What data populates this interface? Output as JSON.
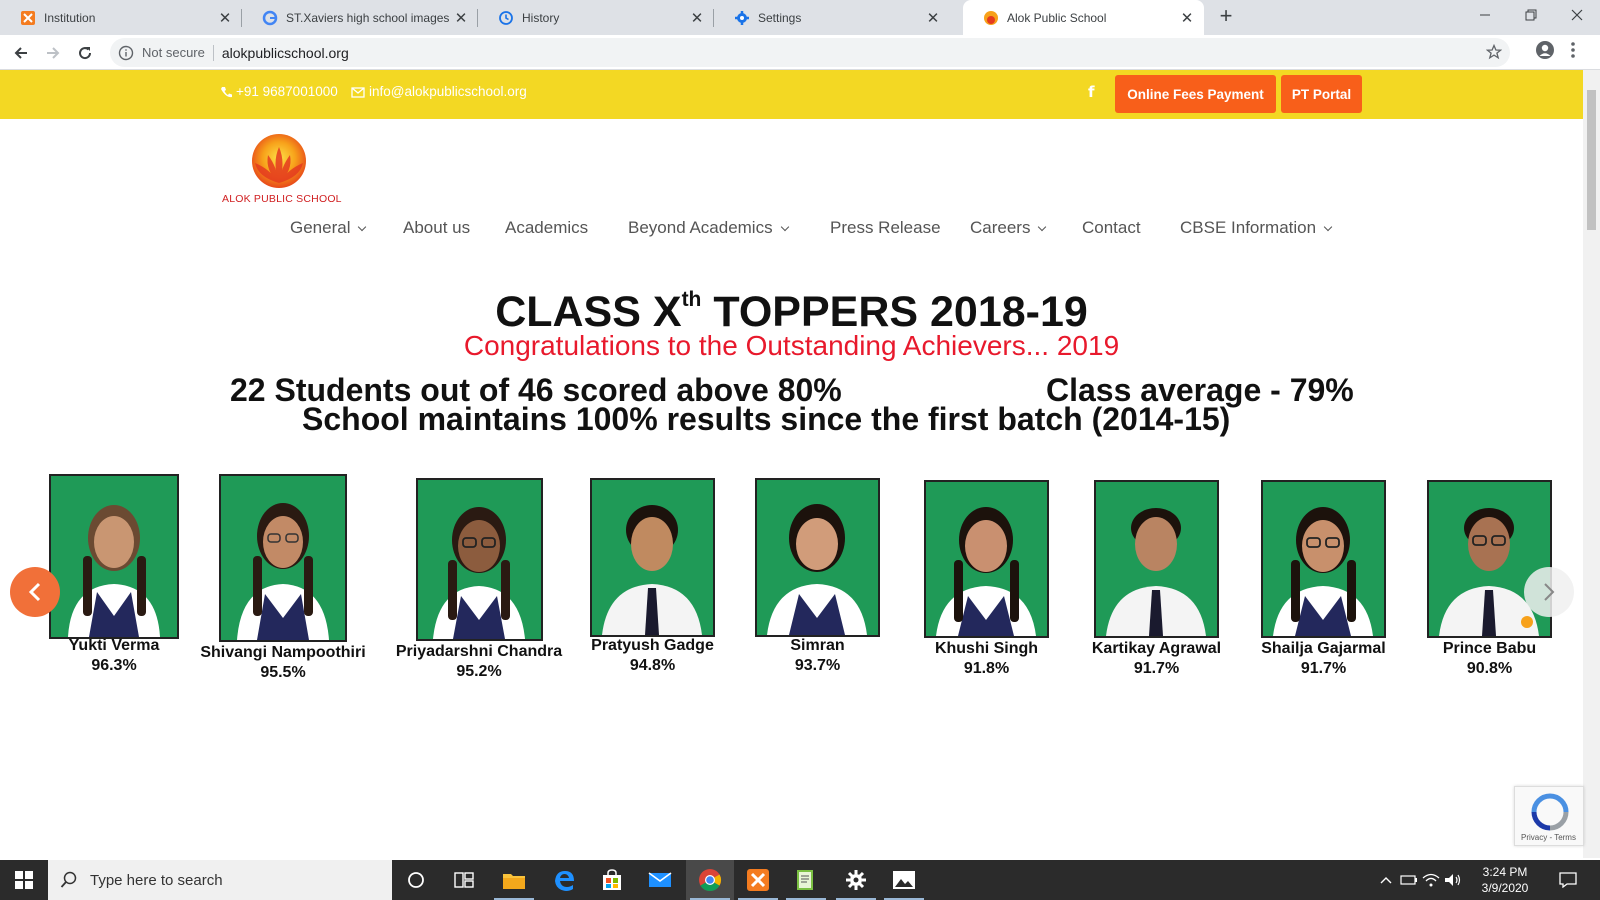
{
  "browser": {
    "tabs": [
      {
        "label": "Institution",
        "icon": "xampp-favicon"
      },
      {
        "label": "ST.Xaviers high school images - G",
        "icon": "google-favicon"
      },
      {
        "label": "History",
        "icon": "history-favicon"
      },
      {
        "label": "Settings",
        "icon": "settings-favicon"
      },
      {
        "label": "Alok Public School",
        "icon": "alok-favicon"
      }
    ],
    "omnibox": {
      "security": "Not secure",
      "url": "alokpublicschool.org"
    }
  },
  "site": {
    "topbar": {
      "phone": "+91 9687001000",
      "email": "info@alokpublicschool.org",
      "facebook": "f",
      "fees_button": "Online Fees Payment",
      "portal_button": "PT Portal"
    },
    "logo_text": "ALOK PUBLIC SCHOOL",
    "nav": [
      {
        "label": "General",
        "dropdown": true
      },
      {
        "label": "About us",
        "dropdown": false
      },
      {
        "label": "Academics",
        "dropdown": false
      },
      {
        "label": "Beyond Academics",
        "dropdown": true
      },
      {
        "label": "Press Release",
        "dropdown": false
      },
      {
        "label": "Careers",
        "dropdown": true
      },
      {
        "label": "Contact",
        "dropdown": false
      },
      {
        "label": "CBSE Information",
        "dropdown": true
      }
    ],
    "banner": {
      "title_pre": "CLASS X",
      "title_sup": "th",
      "title_post": " TOPPERS 2018-19",
      "subtitle": "Congratulations to the Outstanding Achievers... 2019",
      "stat_left": "22 Students out of 46 scored above 80%",
      "stat_right": "Class average - 79%",
      "stat_bottom": "School maintains 100% results since the first batch (2014-15)"
    },
    "students": [
      {
        "name": "Yukti Verma",
        "pct": "96.3%"
      },
      {
        "name": "Shivangi Nampoothiri",
        "pct": "95.5%"
      },
      {
        "name": "Priyadarshni Chandra",
        "pct": "95.2%"
      },
      {
        "name": "Pratyush Gadge",
        "pct": "94.8%"
      },
      {
        "name": "Simran",
        "pct": "93.7%"
      },
      {
        "name": "Khushi Singh",
        "pct": "91.8%"
      },
      {
        "name": "Kartikay Agrawal",
        "pct": "91.7%"
      },
      {
        "name": "Shailja Gajarmal",
        "pct": "91.7%"
      },
      {
        "name": "Prince Babu",
        "pct": "90.8%"
      }
    ],
    "recaptcha": "Privacy - Terms"
  },
  "taskbar": {
    "search_placeholder": "Type here to search",
    "time": "3:24 PM",
    "date": "3/9/2020"
  },
  "colors": {
    "topbar": "#f3d823",
    "button": "#f85f1a",
    "subtitle": "#e8192c",
    "photo_bg": "#1f9a57"
  }
}
